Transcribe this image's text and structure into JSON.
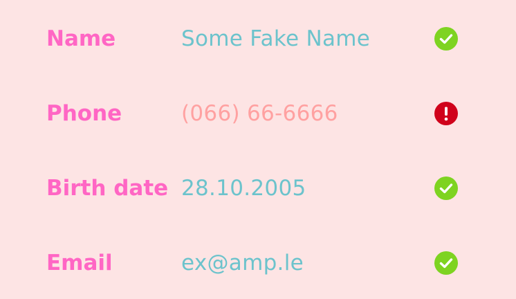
{
  "colors": {
    "background": "#fde4e4",
    "label": "#ff66c4",
    "value_valid": "#6cc3cc",
    "value_invalid": "#ffa1a1",
    "status_valid": "#7ed321",
    "status_invalid": "#d0021b"
  },
  "fields": [
    {
      "label": "Name",
      "value": "Some Fake Name",
      "status": "valid",
      "status_icon": "check-circle-icon"
    },
    {
      "label": "Phone",
      "value": "(066) 66-6666",
      "status": "invalid",
      "status_icon": "exclamation-circle-icon"
    },
    {
      "label": "Birth date",
      "value": "28.10.2005",
      "status": "valid",
      "status_icon": "check-circle-icon"
    },
    {
      "label": "Email",
      "value": "ex@amp.le",
      "status": "valid",
      "status_icon": "check-circle-icon"
    }
  ]
}
